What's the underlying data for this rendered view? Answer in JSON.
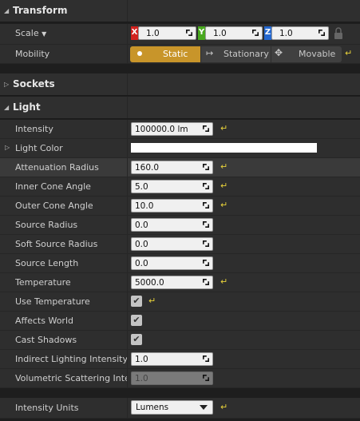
{
  "transform": {
    "title": "Transform",
    "scale_label": "Scale",
    "scale": {
      "x": "1.0",
      "y": "1.0",
      "z": "1.0",
      "x_axis": "X",
      "y_axis": "Y",
      "z_axis": "Z"
    },
    "mobility_label": "Mobility",
    "mobility": {
      "options": [
        "Static",
        "Stationary",
        "Movable"
      ],
      "selected": "Static"
    }
  },
  "sockets": {
    "title": "Sockets"
  },
  "light": {
    "title": "Light",
    "intensity": {
      "label": "Intensity",
      "value": "100000.0 lm"
    },
    "light_color": {
      "label": "Light Color",
      "color": "#ffffff"
    },
    "attenuation_radius": {
      "label": "Attenuation Radius",
      "value": "160.0"
    },
    "inner_cone_angle": {
      "label": "Inner Cone Angle",
      "value": "5.0"
    },
    "outer_cone_angle": {
      "label": "Outer Cone Angle",
      "value": "10.0"
    },
    "source_radius": {
      "label": "Source Radius",
      "value": "0.0"
    },
    "soft_source_radius": {
      "label": "Soft Source Radius",
      "value": "0.0"
    },
    "source_length": {
      "label": "Source Length",
      "value": "0.0"
    },
    "temperature": {
      "label": "Temperature",
      "value": "5000.0"
    },
    "use_temperature": {
      "label": "Use Temperature",
      "checked": true
    },
    "affects_world": {
      "label": "Affects World",
      "checked": true
    },
    "cast_shadows": {
      "label": "Cast Shadows",
      "checked": true
    },
    "indirect_lighting_intensity": {
      "label": "Indirect Lighting Intensity",
      "value": "1.0"
    },
    "volumetric_scattering_intensity": {
      "label": "Volumetric Scattering Intens",
      "value": "1.0"
    }
  },
  "intensity_units": {
    "label": "Intensity Units",
    "value": "Lumens"
  },
  "icons": {
    "reset": "reset-to-default-icon",
    "lock": "lock-icon",
    "check": "checkmark-icon"
  },
  "colors": {
    "accent": "#c8952a",
    "reset": "#e8d23a",
    "x": "#d2221e",
    "y": "#48a81e",
    "z": "#2468d0"
  }
}
